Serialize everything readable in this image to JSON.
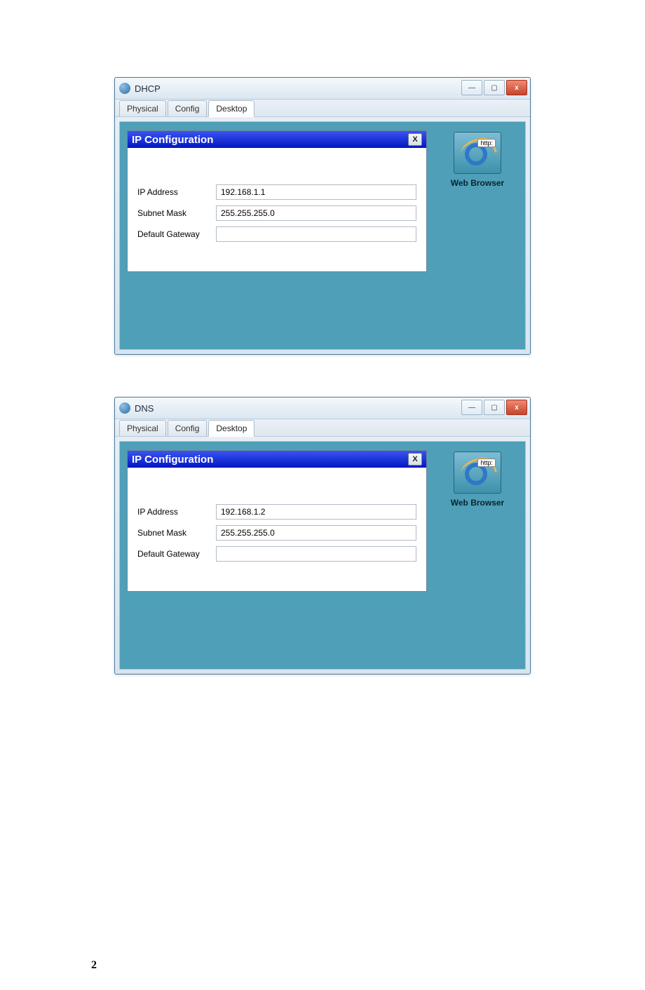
{
  "page_number": "2",
  "windows": [
    {
      "title": "DHCP",
      "tabs": [
        "Physical",
        "Config",
        "Desktop"
      ],
      "active_tab": "Desktop",
      "panel_title": "IP Configuration",
      "fields": {
        "ip_label": "IP Address",
        "ip_value": "192.168.1.1",
        "mask_label": "Subnet Mask",
        "mask_value": "255.255.255.0",
        "gw_label": "Default Gateway",
        "gw_value": ""
      },
      "sidebar": {
        "http_tag": "http:",
        "web_browser_label": "Web Browser"
      },
      "win_ctrl_labels": {
        "min": "—",
        "max": "▢",
        "close": "x"
      },
      "panel_close": "X"
    },
    {
      "title": "DNS",
      "tabs": [
        "Physical",
        "Config",
        "Desktop"
      ],
      "active_tab": "Desktop",
      "panel_title": "IP Configuration",
      "fields": {
        "ip_label": "IP Address",
        "ip_value": "192.168.1.2",
        "mask_label": "Subnet Mask",
        "mask_value": "255.255.255.0",
        "gw_label": "Default Gateway",
        "gw_value": ""
      },
      "sidebar": {
        "http_tag": "http:",
        "web_browser_label": "Web Browser"
      },
      "win_ctrl_labels": {
        "min": "—",
        "max": "▢",
        "close": "x"
      },
      "panel_close": "X"
    }
  ]
}
